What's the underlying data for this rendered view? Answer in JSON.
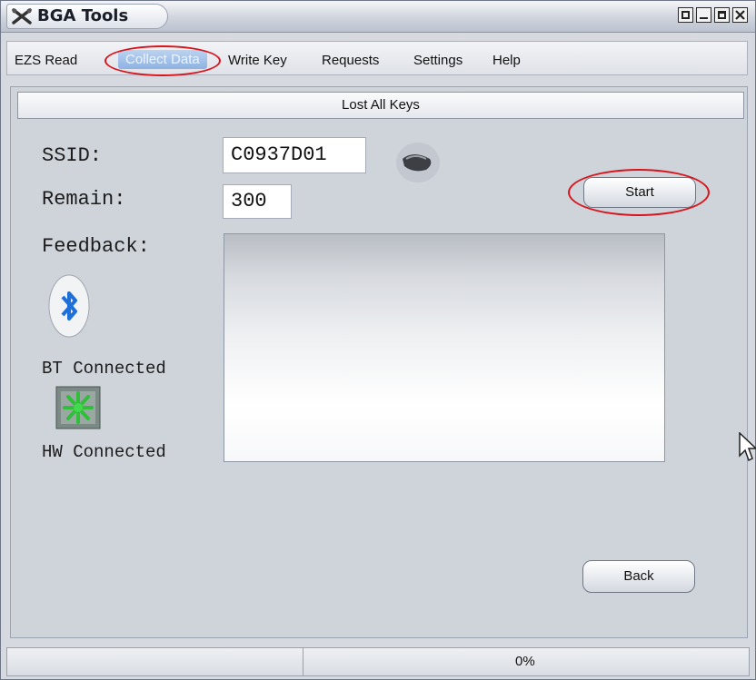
{
  "window": {
    "title": "BGA Tools"
  },
  "menu": {
    "ezs_read": "EZS Read",
    "collect_data": "Collect Data",
    "write_key": "Write Key",
    "requests": "Requests",
    "settings": "Settings",
    "help": "Help"
  },
  "panel": {
    "header": "Lost All Keys",
    "ssid_label": "SSID:",
    "ssid_value": "C0937D01",
    "remain_label": "Remain:",
    "remain_value": "300",
    "feedback_label": "Feedback:",
    "bt_status": "BT Connected",
    "hw_status": "HW Connected",
    "start_button": "Start",
    "back_button": "Back"
  },
  "status": {
    "progress_text": "0%"
  },
  "icons": {
    "app": "tools-icon",
    "key": "car-key-icon",
    "bluetooth": "bluetooth-icon",
    "hardware": "hardware-icon"
  },
  "colors": {
    "highlight_oval": "#d8141c",
    "active_menu": "#8eb2e2",
    "bluetooth": "#1e6fd9",
    "hardware": "#2fbf3a"
  }
}
